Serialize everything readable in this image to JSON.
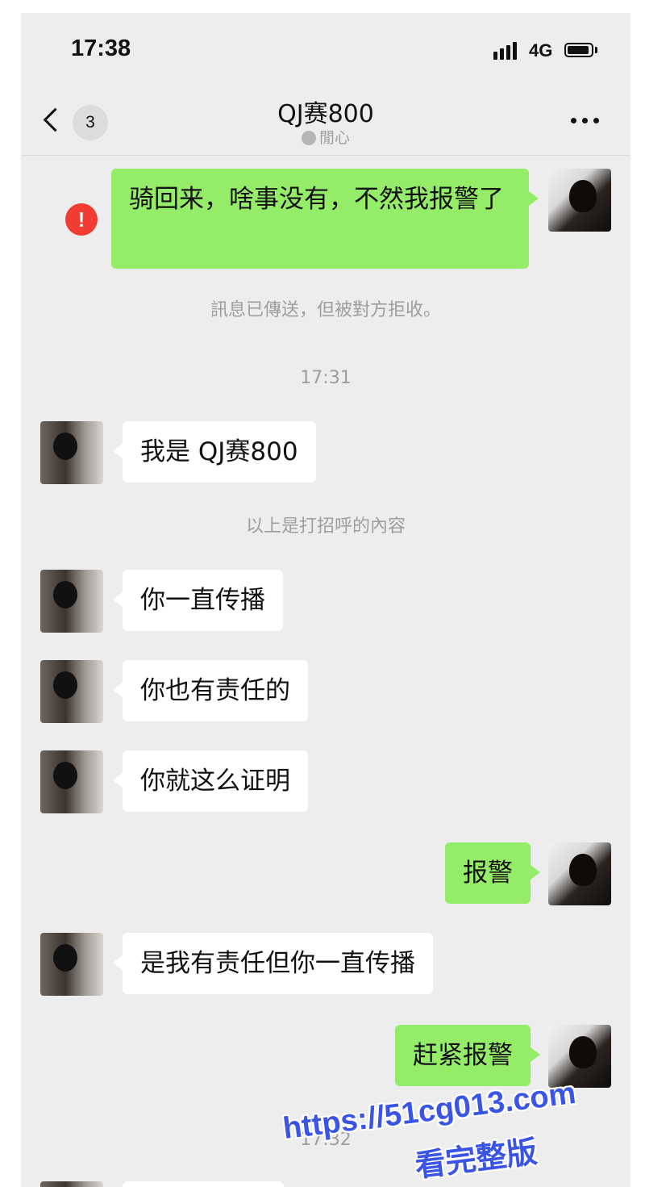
{
  "status_bar": {
    "time": "17:38",
    "network": "4G"
  },
  "nav": {
    "back_count": "3",
    "title": "QJ赛800",
    "subtitle": "閒心",
    "icons": {
      "back": "chevron-left-icon",
      "more": "more-dots-icon",
      "mute": "mute-icon"
    }
  },
  "messages": [
    {
      "direction": "outgoing",
      "text": "骑回来，啥事没有，不然我报警了",
      "failed": true
    },
    {
      "type": "system",
      "text": "訊息已傳送，但被對方拒收。"
    },
    {
      "type": "time",
      "text": "17:31"
    },
    {
      "direction": "incoming",
      "text": "我是 QJ赛800"
    },
    {
      "type": "system",
      "text": "以上是打招呼的內容"
    },
    {
      "direction": "incoming",
      "text": "你一直传播"
    },
    {
      "direction": "incoming",
      "text": "你也有责任的"
    },
    {
      "direction": "incoming",
      "text": "你就这么证明"
    },
    {
      "direction": "outgoing",
      "text": "报警"
    },
    {
      "direction": "incoming",
      "text": "是我有责任但你一直传播"
    },
    {
      "direction": "outgoing",
      "text": "赶紧报警"
    },
    {
      "type": "time",
      "text": "17:32"
    }
  ],
  "error_icon_glyph": "!",
  "watermark": {
    "url": "https://51cg013.com",
    "caption": "看完整版"
  },
  "colors": {
    "chat_background": "#ededed",
    "outgoing_bubble": "#95ec69",
    "incoming_bubble": "#ffffff",
    "error": "#f03c32",
    "watermark": "#3a55e6"
  }
}
